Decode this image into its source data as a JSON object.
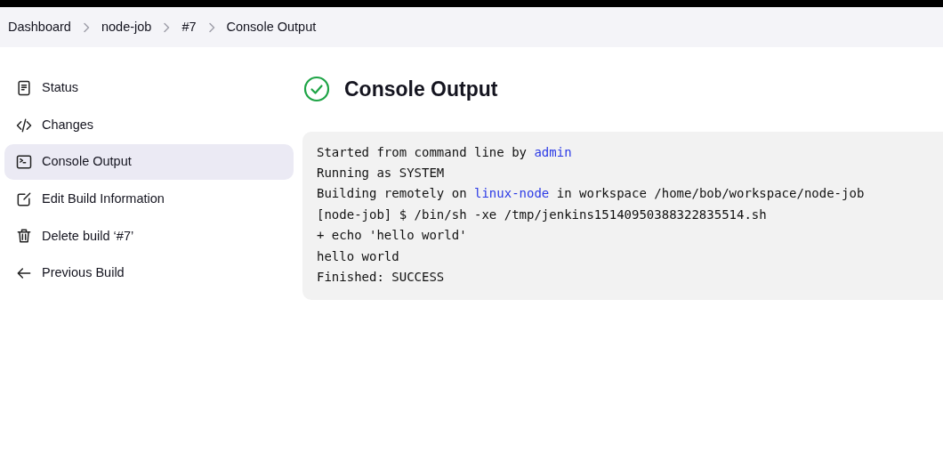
{
  "breadcrumbs": [
    {
      "label": "Dashboard"
    },
    {
      "label": "node-job"
    },
    {
      "label": "#7"
    },
    {
      "label": "Console Output"
    }
  ],
  "sidebar": {
    "items": [
      {
        "label": "Status",
        "kind": "document",
        "selected": false
      },
      {
        "label": "Changes",
        "kind": "code",
        "selected": false
      },
      {
        "label": "Console Output",
        "kind": "terminal",
        "selected": true
      },
      {
        "label": "Edit Build Information",
        "kind": "edit",
        "selected": false
      },
      {
        "label": "Delete build ‘#7’",
        "kind": "trash",
        "selected": false
      },
      {
        "label": "Previous Build",
        "kind": "back",
        "selected": false
      }
    ]
  },
  "page": {
    "title": "Console Output",
    "succeeded": true
  },
  "console": {
    "lines": [
      [
        {
          "kind": "text",
          "text": "Started from command line by "
        },
        {
          "kind": "link",
          "text": "admin"
        }
      ],
      [
        {
          "kind": "text",
          "text": "Running as SYSTEM"
        }
      ],
      [
        {
          "kind": "text",
          "text": "Building remotely on "
        },
        {
          "kind": "link",
          "text": "linux-node"
        },
        {
          "kind": "text",
          "text": " in workspace /home/bob/workspace/node-job"
        }
      ],
      [
        {
          "kind": "text",
          "text": "[node-job] $ /bin/sh -xe /tmp/jenkins15140950388322835514.sh"
        }
      ],
      [
        {
          "kind": "text",
          "text": "+ echo 'hello world'"
        }
      ],
      [
        {
          "kind": "text",
          "text": "hello world"
        }
      ],
      [
        {
          "kind": "text",
          "text": "Finished: SUCCESS"
        }
      ]
    ]
  }
}
